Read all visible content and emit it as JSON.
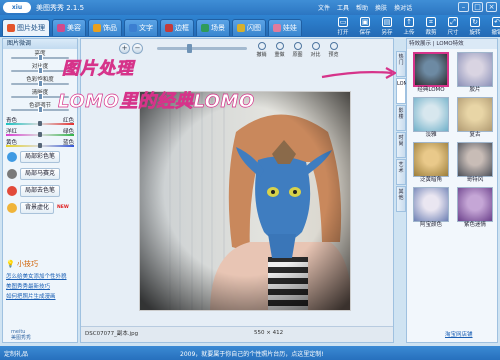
{
  "app": {
    "title": "美图秀秀 2.1.5",
    "logo_text": "xiu"
  },
  "menu": [
    "文件",
    "工具",
    "帮助",
    "换肤",
    "换对话"
  ],
  "tabs": [
    {
      "label": "图片处理",
      "color": "#e3542b"
    },
    {
      "label": "美容",
      "color": "#d04a8c"
    },
    {
      "label": "饰品",
      "color": "#e8a01f"
    },
    {
      "label": "文字",
      "color": "#3c7fd1"
    },
    {
      "label": "边框",
      "color": "#c33b3b"
    },
    {
      "label": "场景",
      "color": "#2f9b5a"
    },
    {
      "label": "闪图",
      "color": "#d7b02c"
    },
    {
      "label": "娃娃",
      "color": "#e07b9c"
    }
  ],
  "toolbar": [
    {
      "label": "打开",
      "icon": "folder-icon"
    },
    {
      "label": "保存",
      "icon": "save-icon"
    },
    {
      "label": "另存",
      "icon": "save-as-icon"
    },
    {
      "label": "上传",
      "icon": "upload-icon"
    },
    {
      "label": "裁剪",
      "icon": "crop-icon"
    },
    {
      "label": "尺寸",
      "icon": "resize-icon"
    },
    {
      "label": "旋转",
      "icon": "rotate-icon"
    },
    {
      "label": "撤销",
      "icon": "undo-icon"
    }
  ],
  "left_panel": {
    "title": "图片微调",
    "sliders": [
      {
        "label": "亮度",
        "value": 0.5
      },
      {
        "label": "对比度",
        "value": 0.5
      },
      {
        "label": "色彩饱和度",
        "value": 0.5
      },
      {
        "label": "清晰度",
        "value": 0.5
      },
      {
        "label": "色调调节",
        "value": 0.5
      }
    ],
    "color_sliders": [
      {
        "left": "青色",
        "right": "红色",
        "gradient": [
          "#19c1c1",
          "#e53131"
        ]
      },
      {
        "left": "洋红",
        "right": "绿色",
        "gradient": [
          "#d93fd1",
          "#32b54a"
        ]
      },
      {
        "left": "黄色",
        "right": "蓝色",
        "gradient": [
          "#e5d22a",
          "#3558d8"
        ]
      }
    ],
    "buttons": [
      {
        "label": "局部彩色笔",
        "icon_color": "#3f9ae3"
      },
      {
        "label": "局部马赛克",
        "icon_color": "#7a7a7a"
      },
      {
        "label": "局部去色笔",
        "icon_color": "#e24a3a"
      },
      {
        "label": "背景虚化",
        "icon_color": "#f0b43a",
        "badge": "NEW"
      }
    ],
    "tips_title": "小技巧",
    "tips": [
      "怎么给美女添加个性外貌",
      "美图秀秀最新技巧",
      "如何把照片生成漫画"
    ],
    "logo_lines": [
      "meitu",
      "美图秀秀"
    ]
  },
  "canvas": {
    "zoom_in": "+",
    "zoom_out": "−",
    "zoom_level": 0.35,
    "edit_tools": [
      "撤销",
      "重做",
      "原图",
      "对比",
      "预览"
    ],
    "filename": "DSC07077_副本.jpg",
    "dimensions": "550 × 412"
  },
  "callout": {
    "line1": "图片处理",
    "line2": "LOMO里的经典LOMO"
  },
  "right_panel": {
    "title": "特效展示 | LOMO特效",
    "vertical_tabs": [
      "热门",
      "LOMO",
      "影楼",
      "时尚",
      "艺术",
      "其他"
    ],
    "effects": [
      {
        "label": "经典LOMO",
        "selected": true,
        "colors": [
          "#2b2b2b",
          "#6d8aa3"
        ]
      },
      {
        "label": "胶片",
        "selected": false,
        "colors": [
          "#8a90b8",
          "#d9d4e2"
        ]
      },
      {
        "label": "淡雅",
        "selected": false,
        "colors": [
          "#6fb0c9",
          "#d7e7ee"
        ]
      },
      {
        "label": "复古",
        "selected": false,
        "colors": [
          "#b09a72",
          "#e8d5a6"
        ]
      },
      {
        "label": "泛黄暗角",
        "selected": false,
        "colors": [
          "#9b7d3a",
          "#e9c98a"
        ]
      },
      {
        "label": "哥特风",
        "selected": false,
        "colors": [
          "#4b4f58",
          "#c8bcb6"
        ]
      },
      {
        "label": "阿宝颜色",
        "selected": false,
        "colors": [
          "#6c7fb4",
          "#eae6f1"
        ]
      },
      {
        "label": "紫色迷情",
        "selected": false,
        "colors": [
          "#6a3f8a",
          "#c5a6d6"
        ]
      }
    ],
    "shop_link": "淘宝网店铺"
  },
  "bottom_bar": {
    "left": "定制礼品",
    "right": "2009，就要属于你自己的个性照片台历，点这里定制!"
  }
}
